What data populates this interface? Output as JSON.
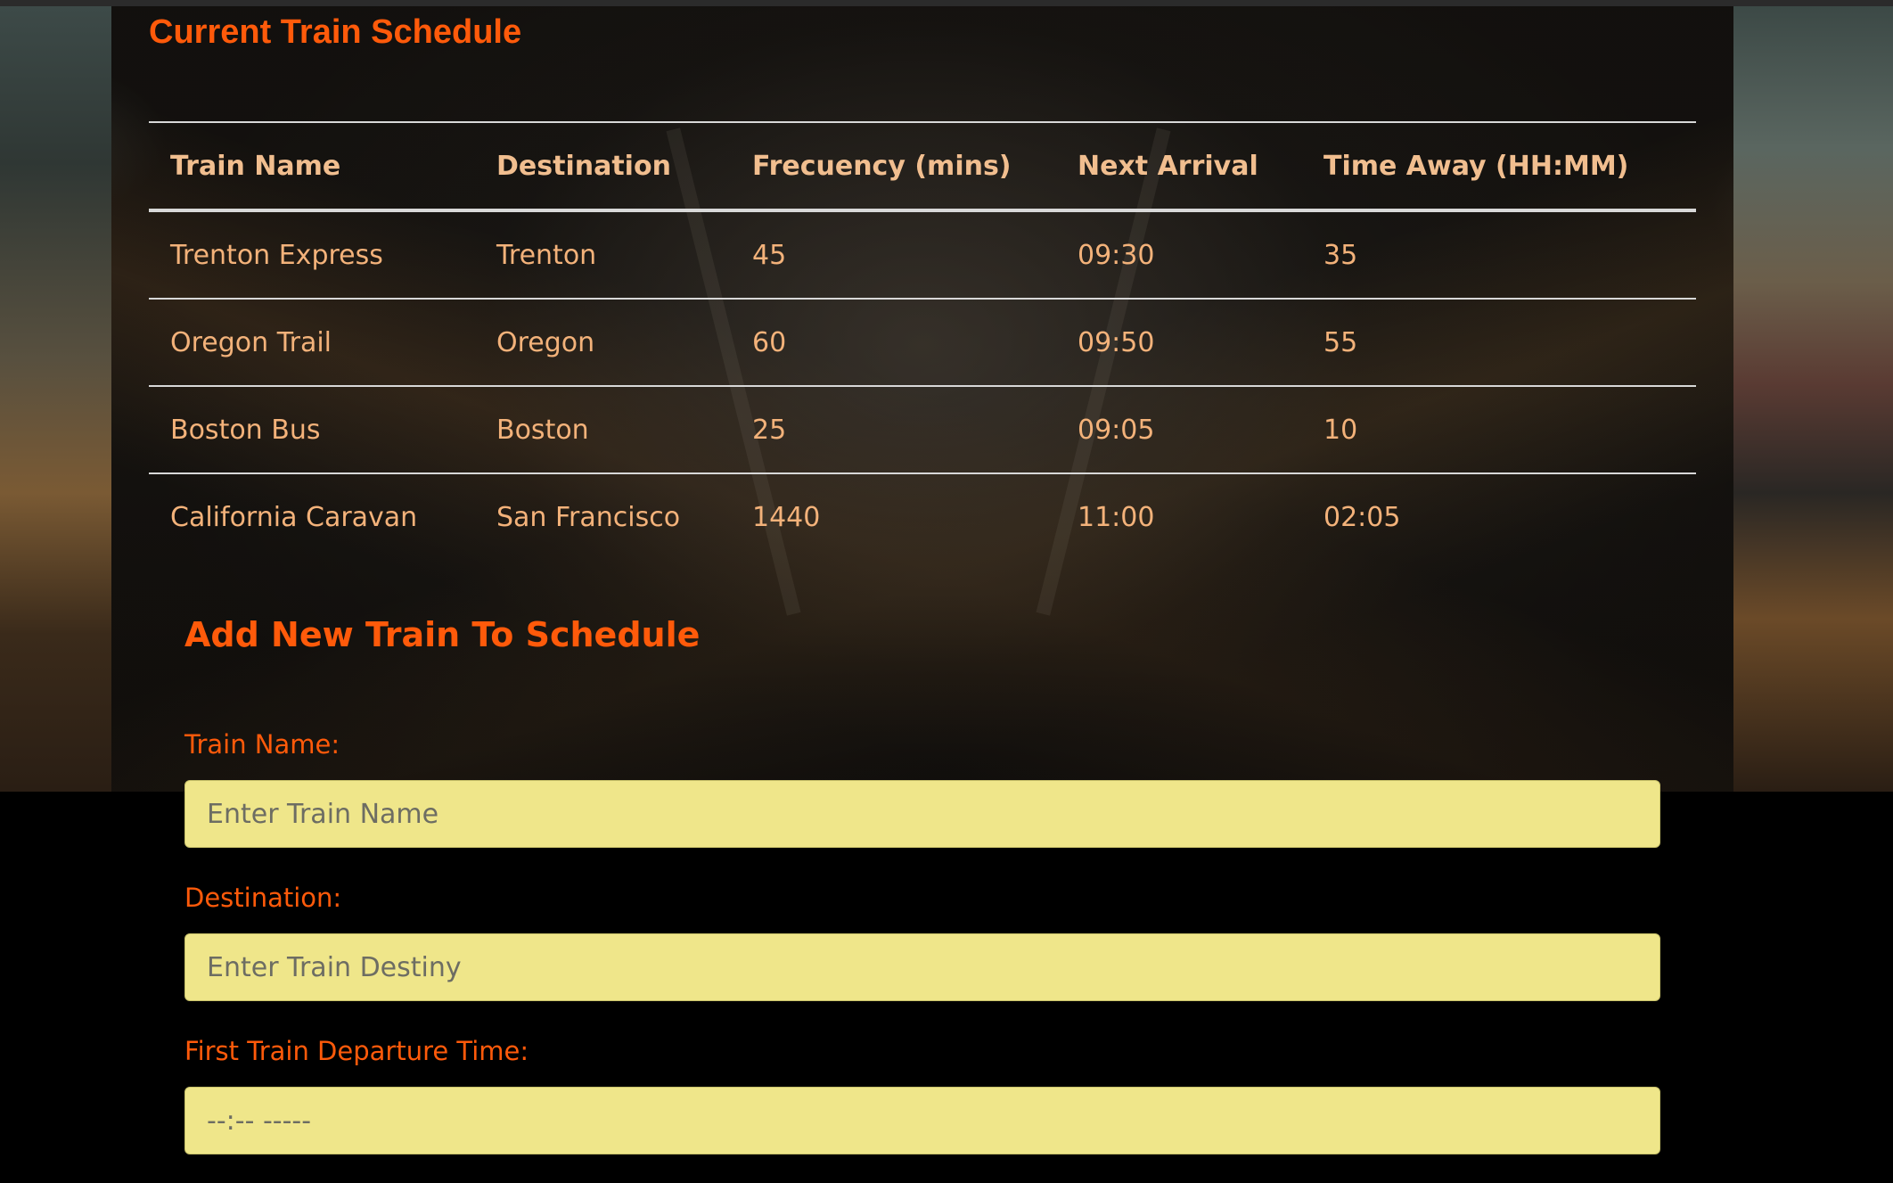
{
  "schedule": {
    "title": "Current Train Schedule",
    "headers": [
      "Train Name",
      "Destination",
      "Frecuency (mins)",
      "Next Arrival",
      "Time Away (HH:MM)"
    ],
    "rows": [
      [
        "Trenton Express",
        "Trenton",
        "45",
        "09:30",
        "35"
      ],
      [
        "Oregon Trail",
        "Oregon",
        "60",
        "09:50",
        "55"
      ],
      [
        "Boston Bus",
        "Boston",
        "25",
        "09:05",
        "10"
      ],
      [
        "California Caravan",
        "San Francisco",
        "1440",
        "11:00",
        "02:05"
      ]
    ]
  },
  "form": {
    "title": "Add New Train To Schedule",
    "train_name_label": "Train Name:",
    "train_name_placeholder": "Enter Train Name",
    "destination_label": "Destination:",
    "destination_placeholder": "Enter Train Destiny",
    "first_time_label": "First Train Departure Time:",
    "first_time_value": "--:-- -----"
  },
  "colors": {
    "accent": "#ff5a0a",
    "table_text": "#f3b27a",
    "input_bg": "#efe68a"
  }
}
